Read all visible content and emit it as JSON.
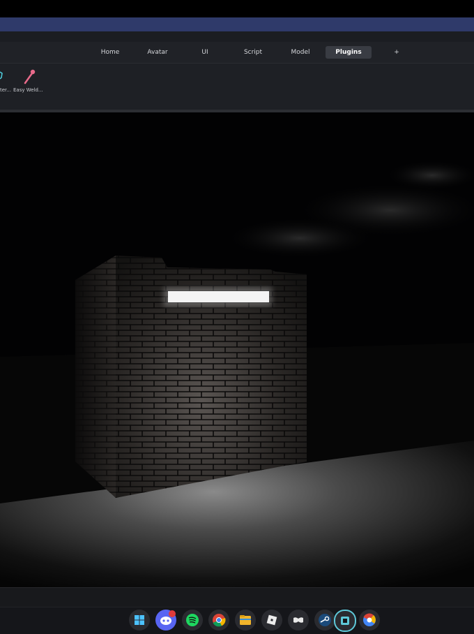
{
  "tabs": [
    {
      "label": "Home",
      "active": false
    },
    {
      "label": "Avatar",
      "active": false
    },
    {
      "label": "UI",
      "active": false
    },
    {
      "label": "Script",
      "active": false
    },
    {
      "label": "Model",
      "active": false
    },
    {
      "label": "Plugins",
      "active": true
    },
    {
      "label": "+",
      "active": false
    }
  ],
  "ribbon": {
    "items": [
      {
        "label": "ter...",
        "icon": "plugin-icon"
      },
      {
        "label": "Easy Weld...",
        "icon": "weld-icon"
      }
    ]
  },
  "taskbar": {
    "icons": [
      "windows-start-icon",
      "discord-icon",
      "spotify-icon",
      "chrome-icon",
      "file-explorer-icon",
      "roblox-icon",
      "game-icon",
      "steam-icon",
      "roblox-studio-icon",
      "chrome-alt-icon"
    ],
    "discord_badge_color": "#e03b3b"
  },
  "colors": {
    "titlebar": "#2f3a6a",
    "tab_active": "#393c43",
    "ribbon": "#1e2025"
  }
}
